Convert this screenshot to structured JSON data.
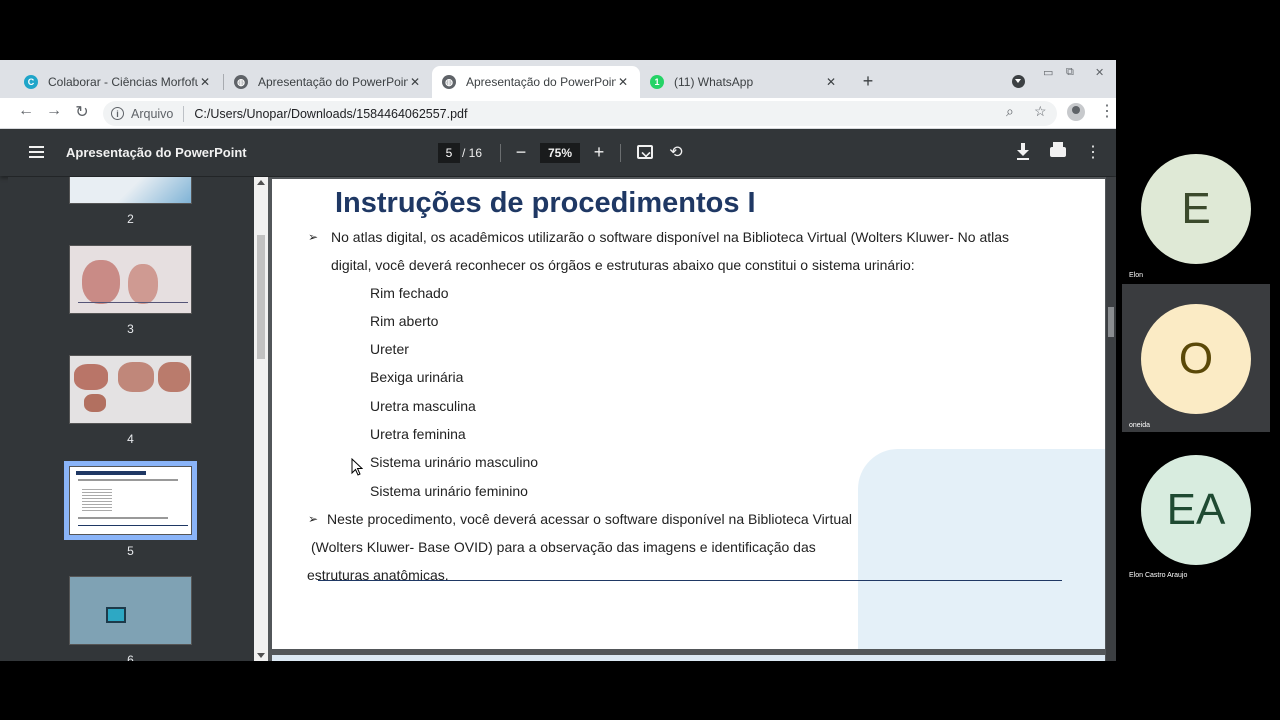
{
  "browser": {
    "tabs": [
      {
        "title": "Colaborar - Ciências Morfofuncio",
        "favicon": "colaborar-icon",
        "active": false
      },
      {
        "title": "Apresentação do PowerPoint",
        "favicon": "globe-icon",
        "active": false
      },
      {
        "title": "Apresentação do PowerPoint",
        "favicon": "globe-icon",
        "active": true
      },
      {
        "title": "(11) WhatsApp",
        "favicon": "whatsapp-icon",
        "active": false
      }
    ],
    "scheme_label": "Arquivo",
    "url": "C:/Users/Unopar/Downloads/1584464062557.pdf"
  },
  "pdf_viewer": {
    "title": "Apresentação do PowerPoint",
    "current_page": "5",
    "total_pages": "/ 16",
    "zoom": "75%",
    "thumbnails": [
      {
        "number": "2"
      },
      {
        "number": "3"
      },
      {
        "number": "4"
      },
      {
        "number": "5",
        "selected": true
      },
      {
        "number": "6"
      }
    ]
  },
  "slide": {
    "title": "Instruções de procedimentos I",
    "bullet1_line1": "No atlas digital, os acadêmicos utilizarão o software disponível na Biblioteca Virtual (Wolters Kluwer- No atlas",
    "bullet1_line2": "digital, você deverá reconhecer os órgãos e estruturas abaixo que constitui o sistema urinário:",
    "items": [
      "Rim fechado",
      "Rim aberto",
      "Ureter",
      "Bexiga urinária",
      "Uretra masculina",
      "Uretra feminina",
      "Sistema urinário masculino",
      "Sistema urinário feminino"
    ],
    "bullet2_line1": "Neste procedimento, você deverá acessar o software disponível na Biblioteca Virtual",
    "bullet2_line2": "(Wolters Kluwer- Base OVID) para a observação das imagens e identificação das",
    "bullet2_line3": "estruturas anatômicas."
  },
  "participants": [
    {
      "initials": "E",
      "name": "Elon",
      "color": "#dfe9d6",
      "text_color": "#3b4a2c"
    },
    {
      "initials": "O",
      "name": "oneida",
      "color": "#fbebc5",
      "text_color": "#5a4808"
    },
    {
      "initials": "EA",
      "name": "Elon Castro Araujo",
      "color": "#d8ecdf",
      "text_color": "#1f4a32"
    }
  ]
}
